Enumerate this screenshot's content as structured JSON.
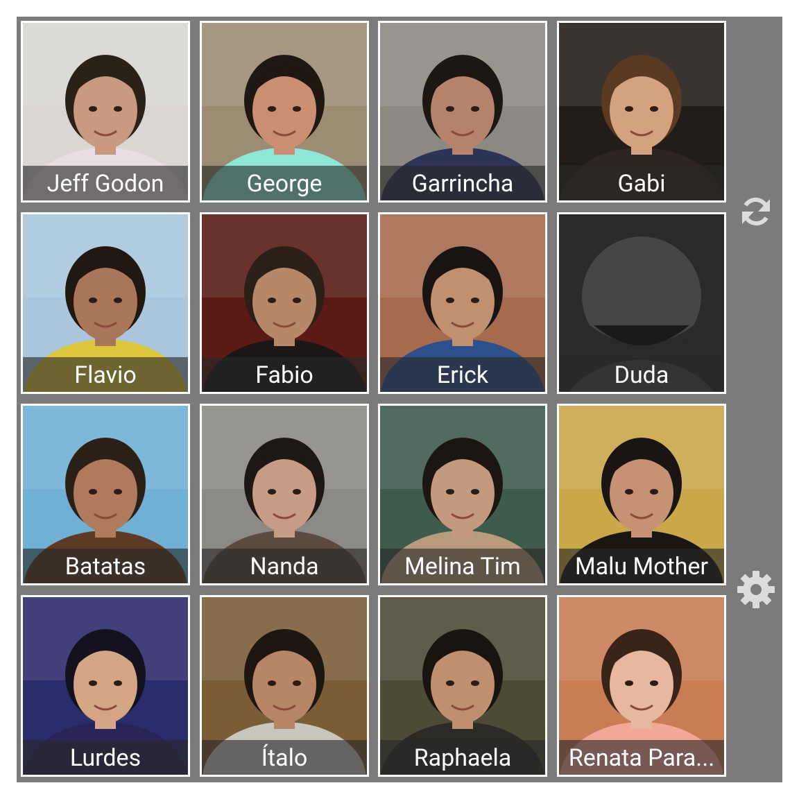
{
  "contacts": [
    {
      "name": "Jeff Godon",
      "bg": "#d9d6d3",
      "skin": "#c99a80",
      "hair": "#2a2119",
      "shirt": "#e7dde3"
    },
    {
      "name": "George",
      "bg": "#9c8c74",
      "skin": "#c98f70",
      "hair": "#1f1712",
      "shirt": "#8fe6d6"
    },
    {
      "name": "Garrincha",
      "bg": "#8c8a80",
      "skin": "#b7826b",
      "hair": "#1d1714",
      "shirt": "#2e3457"
    },
    {
      "name": "Gabi",
      "bg": "#231d17",
      "skin": "#d4a27e",
      "hair": "#5a3a22",
      "shirt": "#2d2520"
    },
    {
      "name": "Flavio",
      "bg": "#a9c6dc",
      "skin": "#a9765a",
      "hair": "#211812",
      "shirt": "#dcc63e"
    },
    {
      "name": "Fabio",
      "bg": "#5a1b16",
      "skin": "#b68867",
      "hair": "#2b1f17",
      "shirt": "#1a1716"
    },
    {
      "name": "Erick",
      "bg": "#a66a4f",
      "skin": "#c0906f",
      "hair": "#191412",
      "shirt": "#2d4f8c"
    },
    {
      "name": "Duda",
      "bg": "#2a2a2a",
      "placeholder": true
    },
    {
      "name": "Batatas",
      "bg": "#6fb0d4",
      "skin": "#b07b5d",
      "hair": "#2a2018",
      "shirt": "#5c3a24"
    },
    {
      "name": "Nanda",
      "bg": "#8c8a86",
      "skin": "#c79c84",
      "hair": "#1e1814",
      "shirt": "#5b4a40"
    },
    {
      "name": "Melina Tim",
      "bg": "#3e5b4e",
      "skin": "#c49a7f",
      "hair": "#1c1612",
      "shirt": "#b89b7c"
    },
    {
      "name": "Malu Mother",
      "bg": "#c9a84a",
      "skin": "#c69273",
      "hair": "#1a1513",
      "shirt": "#1a1614"
    },
    {
      "name": "Lurdes",
      "bg": "#2b2c6b",
      "skin": "#d3a584",
      "hair": "#14121e",
      "shirt": "#2a2458"
    },
    {
      "name": "Ítalo",
      "bg": "#7a5d37",
      "skin": "#b88666",
      "hair": "#1d1611",
      "shirt": "#c9c6c0"
    },
    {
      "name": "Raphaela",
      "bg": "#4d4b35",
      "skin": "#c08f70",
      "hair": "#1a1410",
      "shirt": "#2b2a25"
    },
    {
      "name": "Renata Para...",
      "bg": "#c97d55",
      "skin": "#e6b8a0",
      "hair": "#3a2419",
      "shirt": "#f2a896"
    }
  ],
  "controls": {
    "refresh_icon": "refresh-icon",
    "settings_icon": "gear-icon",
    "icon_color": "#dcdcdc"
  },
  "colors": {
    "frame": "#7b7b7b",
    "tile_border": "#ffffff",
    "name_bar": "rgba(40,40,40,0.62)"
  }
}
